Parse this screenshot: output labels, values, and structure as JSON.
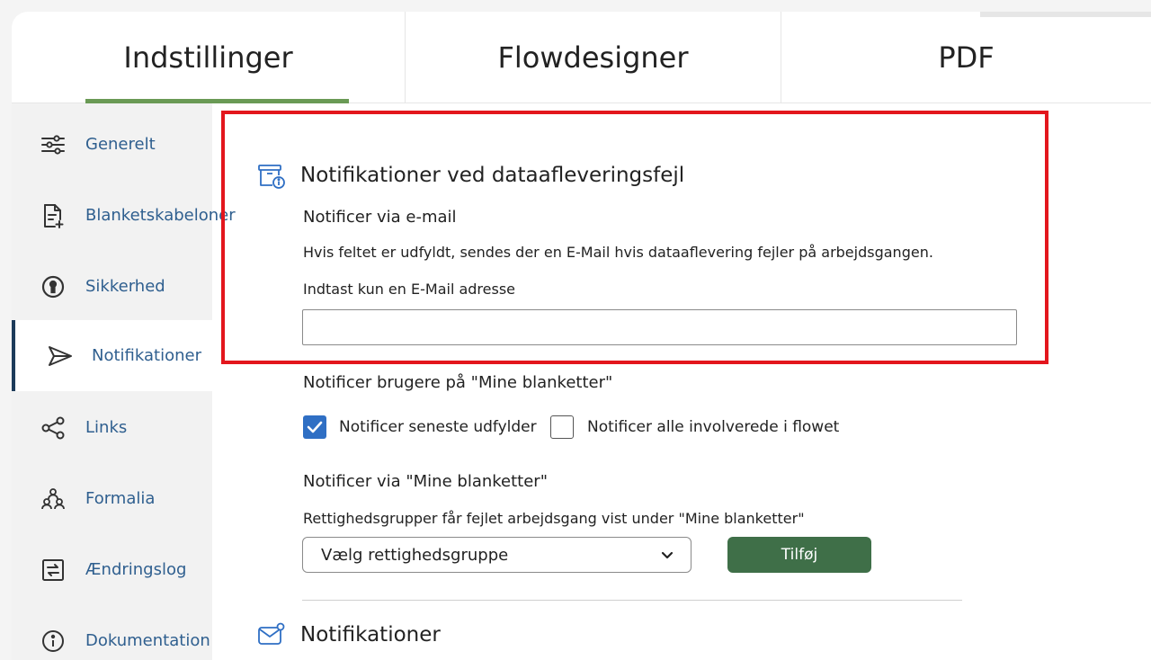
{
  "tabs": [
    {
      "label": "Indstillinger",
      "active": true
    },
    {
      "label": "Flowdesigner",
      "active": false
    },
    {
      "label": "PDF",
      "active": false
    }
  ],
  "sidebar": {
    "items": [
      {
        "label": "Generelt",
        "icon": "sliders-icon"
      },
      {
        "label": "Blanketskabeloner",
        "icon": "document-add-icon"
      },
      {
        "label": "Sikkerhed",
        "icon": "keyhole-icon"
      },
      {
        "label": "Notifikationer",
        "icon": "send-icon",
        "active": true
      },
      {
        "label": "Links",
        "icon": "share-icon"
      },
      {
        "label": "Formalia",
        "icon": "people-icon"
      },
      {
        "label": "Ændringslog",
        "icon": "swap-icon"
      },
      {
        "label": "Dokumentation",
        "icon": "info-icon"
      }
    ]
  },
  "section_errors": {
    "title": "Notifikationer ved dataafleveringsfejl",
    "email": {
      "heading": "Notificer via e-mail",
      "description": "Hvis feltet er udfyldt, sendes der en E-Mail hvis dataaflevering fejler på arbejdsgangen.",
      "field_label": "Indtast kun en E-Mail adresse",
      "value": "",
      "placeholder": ""
    },
    "users": {
      "heading": "Notificer brugere på \"Mine blanketter\"",
      "checkbox_latest": {
        "label": "Notificer seneste udfylder",
        "checked": true
      },
      "checkbox_all": {
        "label": "Notificer alle involverede i flowet",
        "checked": false
      }
    },
    "groups": {
      "heading": "Notificer via \"Mine blanketter\"",
      "description": "Rettighedsgrupper får fejlet arbejdsgang vist under \"Mine blanketter\"",
      "select_value": "Vælg rettighedsgruppe",
      "add_label": "Tilføj"
    }
  },
  "section_notifications": {
    "title": "Notifikationer"
  },
  "colors": {
    "accent_green": "#6a9a55",
    "button_green": "#3f6f48",
    "link_blue": "#2f5f8f",
    "highlight_red": "#e3161d",
    "checkbox_blue": "#2f6fc4"
  }
}
